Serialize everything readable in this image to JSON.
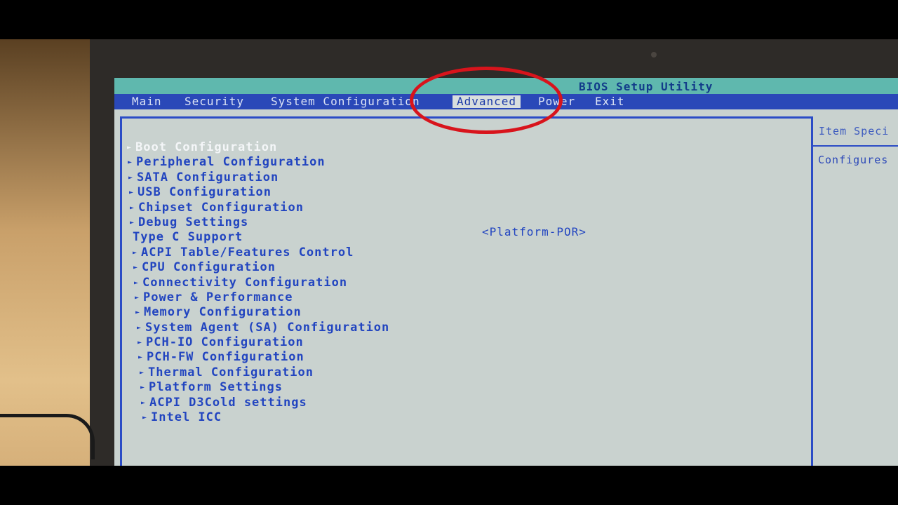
{
  "title": "BIOS Setup Utility",
  "menu": [
    {
      "label": "Main"
    },
    {
      "label": "Security"
    },
    {
      "label": "System Configuration"
    },
    {
      "label": "Advanced"
    },
    {
      "label": "Power"
    },
    {
      "label": "Exit"
    }
  ],
  "active_tab": "Advanced",
  "items": [
    {
      "label": "Boot Configuration"
    },
    {
      "label": "Peripheral Configuration"
    },
    {
      "label": "SATA Configuration"
    },
    {
      "label": "USB Configuration"
    },
    {
      "label": "Chipset Configuration"
    },
    {
      "label": "Debug Settings"
    },
    {
      "label": "Type C Support"
    },
    {
      "label": "ACPI Table/Features Control"
    },
    {
      "label": "CPU Configuration"
    },
    {
      "label": "Connectivity Configuration"
    },
    {
      "label": "Power & Performance"
    },
    {
      "label": "Memory Configuration"
    },
    {
      "label": "System Agent (SA) Configuration"
    },
    {
      "label": "PCH-IO Configuration"
    },
    {
      "label": "PCH-FW Configuration"
    },
    {
      "label": "Thermal Configuration"
    },
    {
      "label": "Platform Settings"
    },
    {
      "label": "ACPI D3Cold settings"
    },
    {
      "label": "Intel ICC"
    }
  ],
  "type_c_value": "<Platform-POR>",
  "help": {
    "header": "Item Speci",
    "text": "Configures"
  },
  "colors": {
    "menu_bar": "#2a48b8",
    "title_bar": "#5fb8ae",
    "screen_bg": "#c9d2cf",
    "item_text": "#2245c0",
    "annotation": "#d8141c"
  }
}
